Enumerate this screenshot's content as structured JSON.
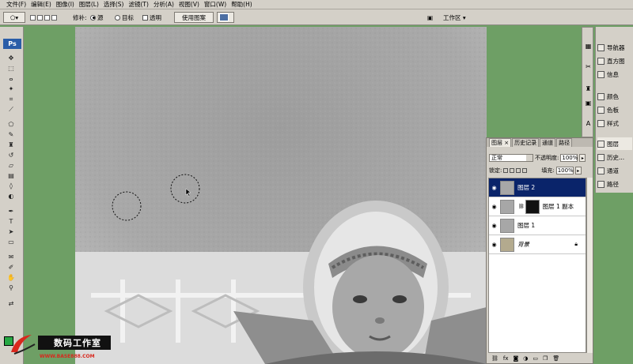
{
  "menu": [
    "文件(F)",
    "编辑(E)",
    "图像(I)",
    "图层(L)",
    "选择(S)",
    "滤镜(T)",
    "分析(A)",
    "视图(V)",
    "窗口(W)",
    "帮助(H)"
  ],
  "options": {
    "repair_label": "修补:",
    "source_label": "源",
    "target_label": "目标",
    "transparent_label": "透明",
    "use_pattern_button": "使用图案",
    "workspace_label": "工作区 ▾"
  },
  "toolbar": {
    "logo": "Ps"
  },
  "layers_panel": {
    "tabs": [
      "图层 ×",
      "历史记录",
      "通道",
      "路径"
    ],
    "blend_mode": "正常",
    "opacity_label": "不透明度:",
    "opacity_value": "100%",
    "lock_label": "锁定:",
    "fill_label": "填充:",
    "fill_value": "100%",
    "layers": [
      {
        "name": "图层 2",
        "selected": true
      },
      {
        "name": "图层 1 副本",
        "selected": false,
        "has_mask": true
      },
      {
        "name": "图层 1",
        "selected": false
      },
      {
        "name": "背景",
        "selected": false,
        "locked": true
      }
    ],
    "footer_icons": [
      "link-icon",
      "fx-icon",
      "mask-icon",
      "adjustment-icon",
      "folder-icon",
      "new-layer-icon",
      "trash-icon"
    ]
  },
  "right_panel": {
    "items": [
      {
        "label": "导航器",
        "selected": false
      },
      {
        "label": "直方图",
        "selected": false
      },
      {
        "label": "信息",
        "selected": false
      },
      {
        "label": "颜色",
        "selected": false
      },
      {
        "label": "色板",
        "selected": false
      },
      {
        "label": "样式",
        "selected": false
      },
      {
        "label": "图层",
        "selected": true
      },
      {
        "label": "历史...",
        "selected": false
      },
      {
        "label": "通道",
        "selected": false
      },
      {
        "label": "路径",
        "selected": false
      }
    ]
  },
  "watermark": {
    "title": "数码工作室",
    "url": "WWW.BASE888.COM"
  },
  "colors": {
    "ui_gray": "#d4d0c8",
    "selected_layer": "#0a246a",
    "workspace_green": "#6e9f65",
    "foreground": "#27a844"
  }
}
